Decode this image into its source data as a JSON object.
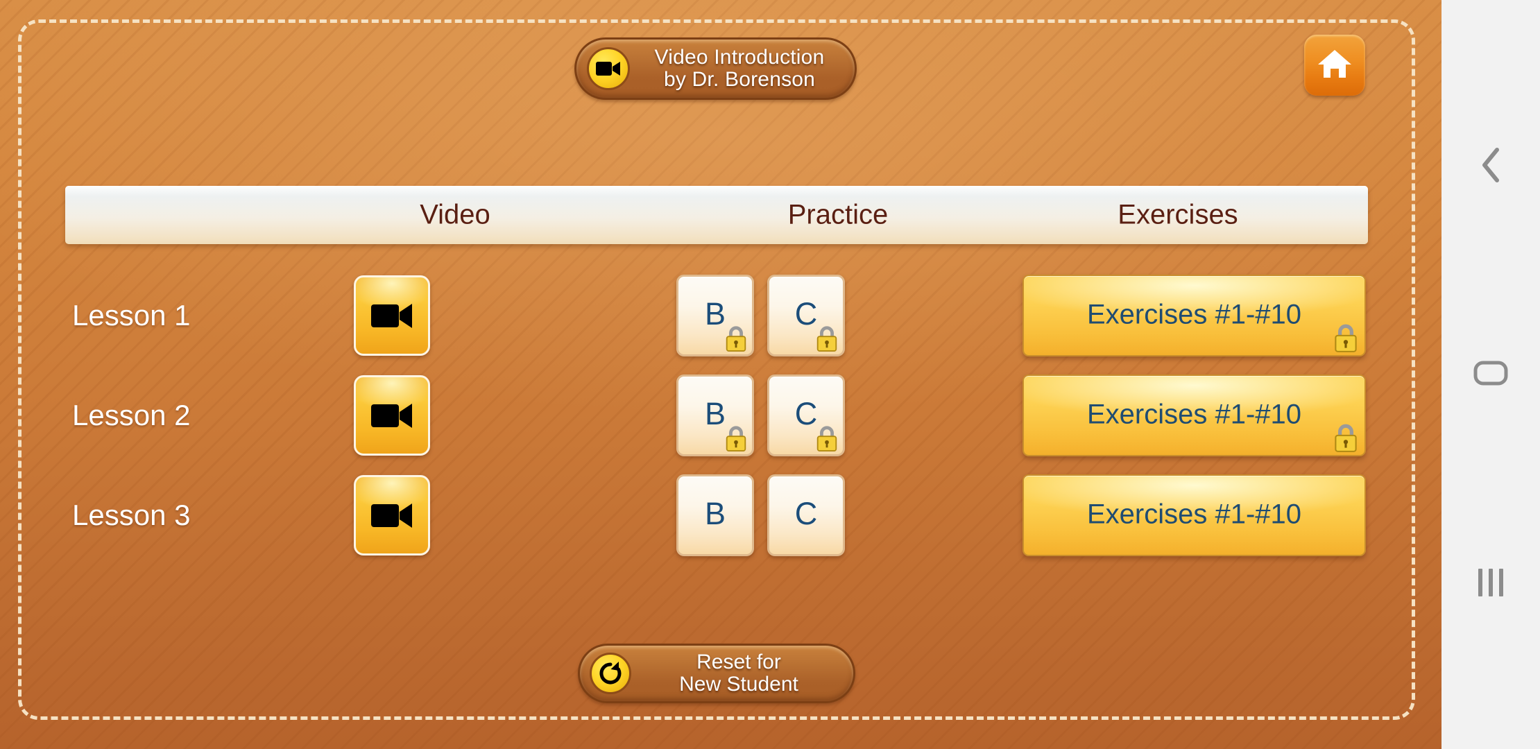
{
  "app": {
    "background_top_color": "#d98f47",
    "background_bottom_color": "#b6632c",
    "frame_border_color": "#f6e2c3"
  },
  "topbar": {
    "video_intro": {
      "line1": "Video Introduction",
      "line2": "by Dr. Borenson",
      "icon": "video-camera-icon",
      "icon_bg_color": "#ffd426"
    },
    "home_button": {
      "icon": "home-icon",
      "bg_color": "#ef8f22",
      "icon_color": "#ffffff"
    }
  },
  "table": {
    "columns": [
      "Video",
      "Practice",
      "Exercises"
    ],
    "header_text_color": "#5a1f12",
    "rows": [
      {
        "lesson": "Lesson 1",
        "video": {
          "icon": "video-camera-icon",
          "locked": false
        },
        "practice": [
          {
            "label": "B",
            "locked": true
          },
          {
            "label": "C",
            "locked": true
          }
        ],
        "exercises": {
          "label": "Exercises #1-#10",
          "locked": true
        }
      },
      {
        "lesson": "Lesson 2",
        "video": {
          "icon": "video-camera-icon",
          "locked": false
        },
        "practice": [
          {
            "label": "B",
            "locked": true
          },
          {
            "label": "C",
            "locked": true
          }
        ],
        "exercises": {
          "label": "Exercises #1-#10",
          "locked": true
        }
      },
      {
        "lesson": "Lesson 3",
        "video": {
          "icon": "video-camera-icon",
          "locked": false
        },
        "practice": [
          {
            "label": "B",
            "locked": false
          },
          {
            "label": "C",
            "locked": false
          }
        ],
        "exercises": {
          "label": "Exercises #1-#10",
          "locked": false
        }
      }
    ],
    "practice_letter_color": "#1b4d7a",
    "exercise_text_color": "#1f4c72",
    "lock_icon": "lock-icon",
    "lock_body_color": "#f5cf3a"
  },
  "reset": {
    "line1": "Reset for",
    "line2": "New Student",
    "icon": "reset-arrow-icon"
  },
  "navbar": {
    "back": {
      "icon": "chevron-left-icon"
    },
    "home": {
      "icon": "home-square-icon"
    },
    "recents": {
      "icon": "recents-bars-icon"
    },
    "bg_color": "#f2f2f2",
    "icon_color": "#8c8c8c"
  }
}
